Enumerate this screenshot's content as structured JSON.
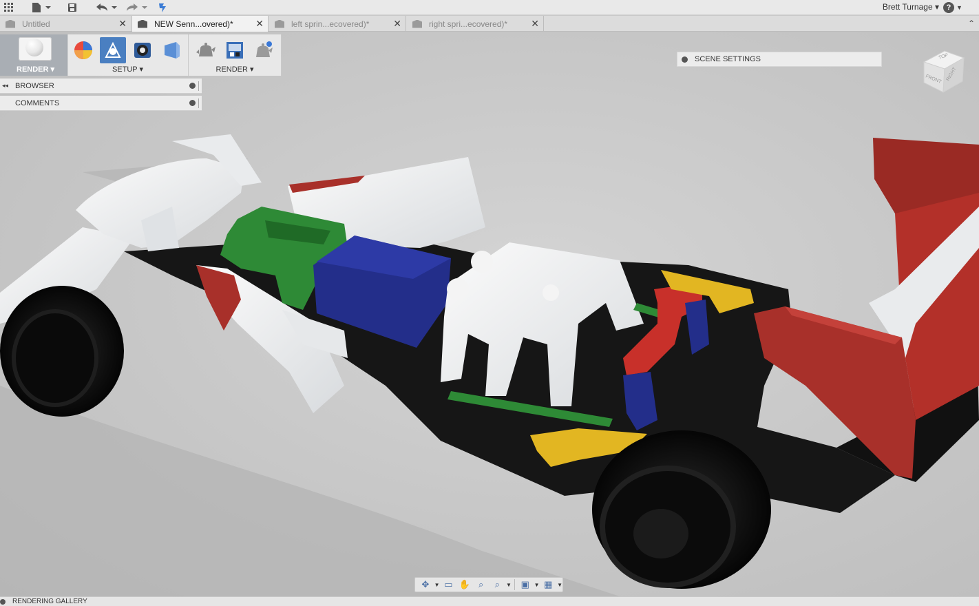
{
  "appbar": {
    "user_name": "Brett Turnage",
    "help_label": "?"
  },
  "tabs": [
    {
      "label": "Untitled",
      "active": false
    },
    {
      "label": "NEW Senn...overed)*",
      "active": true
    },
    {
      "label": "left sprin...ecovered)*",
      "active": false
    },
    {
      "label": "right spri...ecovered)*",
      "active": false
    }
  ],
  "toolbar": {
    "workspace_label": "RENDER ▾",
    "setup_label": "SETUP ▾",
    "render_label": "RENDER ▾"
  },
  "browser": {
    "browser_label": "BROWSER",
    "comments_label": "COMMENTS"
  },
  "scene_settings": {
    "label": "SCENE SETTINGS"
  },
  "viewcube": {
    "top": "TOP",
    "front": "FRONT",
    "right": "RIGHT"
  },
  "gallery": {
    "label": "RENDERING GALLERY"
  },
  "colors": {
    "chassis": "#161616",
    "body_white": "#eef0f2",
    "green": "#2e8a36",
    "blue": "#232e8a",
    "red": "#9a2a24",
    "yellow": "#e2b622",
    "tire": "#111111",
    "accent_blue": "#4a7fc1"
  }
}
